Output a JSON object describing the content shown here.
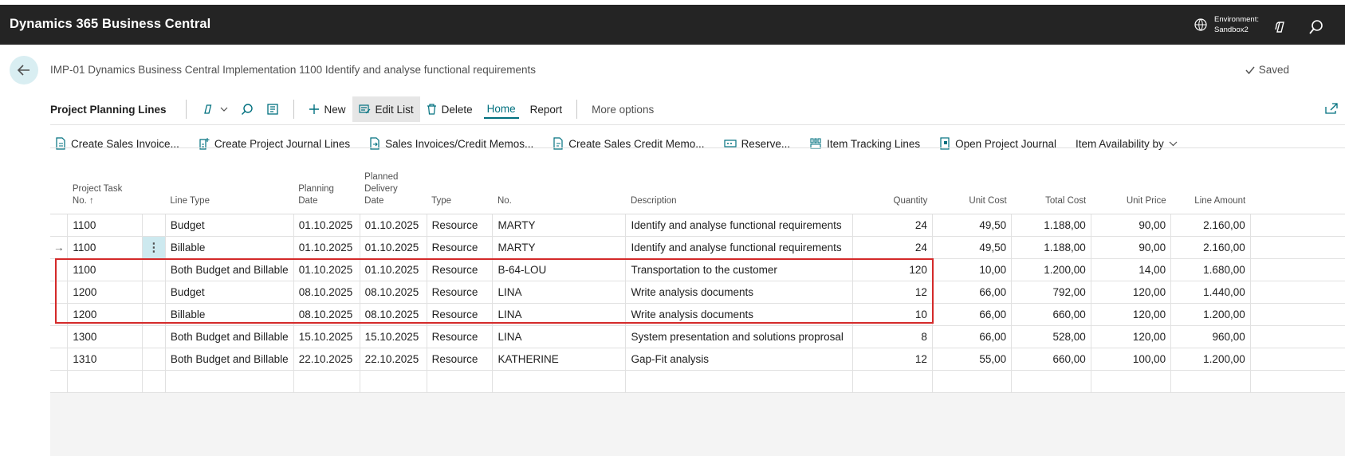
{
  "app": {
    "title": "Dynamics 365 Business Central",
    "environment_label": "Environment:",
    "environment_value": "Sandbox2"
  },
  "header": {
    "breadcrumb": "IMP-01 Dynamics Business Central Implementation 1100 Identify and analyse functional requirements",
    "saved": "Saved"
  },
  "actionbar": {
    "page_name": "Project Planning Lines",
    "new_label": "New",
    "edit_list_label": "Edit List",
    "delete_label": "Delete",
    "home_label": "Home",
    "report_label": "Report",
    "more_options_label": "More options"
  },
  "promoted": {
    "create_sales_invoice": "Create Sales Invoice...",
    "create_project_journal_lines": "Create Project Journal Lines",
    "sales_invoices_credit_memos": "Sales Invoices/Credit Memos...",
    "create_sales_credit_memo": "Create Sales Credit Memo...",
    "reserve": "Reserve...",
    "item_tracking_lines": "Item Tracking Lines",
    "open_project_journal": "Open Project Journal",
    "item_availability_by": "Item Availability by"
  },
  "table": {
    "headers": {
      "project_task_no_1": "Project Task",
      "project_task_no_2": "No. ↑",
      "line_type": "Line Type",
      "planning_date_1": "Planning",
      "planning_date_2": "Date",
      "planned_delivery_1": "Planned",
      "planned_delivery_2": "Delivery",
      "planned_delivery_3": "Date",
      "type": "Type",
      "no": "No.",
      "description": "Description",
      "quantity": "Quantity",
      "unit_cost": "Unit Cost",
      "total_cost": "Total Cost",
      "unit_price": "Unit Price",
      "line_amount": "Line Amount"
    },
    "current_row_indicator": "→",
    "rows": [
      {
        "task": "1100",
        "line_type": "Budget",
        "planning_date": "01.10.2025",
        "delivery_date": "01.10.2025",
        "type": "Resource",
        "no": "MARTY",
        "description": "Identify and analyse functional requirements",
        "quantity": "24",
        "unit_cost": "49,50",
        "total_cost": "1.188,00",
        "unit_price": "90,00",
        "line_amount": "2.160,00"
      },
      {
        "task": "1100",
        "line_type": "Billable",
        "planning_date": "01.10.2025",
        "delivery_date": "01.10.2025",
        "type": "Resource",
        "no": "MARTY",
        "description": "Identify and analyse functional requirements",
        "quantity": "24",
        "unit_cost": "49,50",
        "total_cost": "1.188,00",
        "unit_price": "90,00",
        "line_amount": "2.160,00"
      },
      {
        "task": "1100",
        "line_type": "Both Budget and Billable",
        "planning_date": "01.10.2025",
        "delivery_date": "01.10.2025",
        "type": "Resource",
        "no": "B-64-LOU",
        "description": "Transportation to the customer",
        "quantity": "120",
        "unit_cost": "10,00",
        "total_cost": "1.200,00",
        "unit_price": "14,00",
        "line_amount": "1.680,00"
      },
      {
        "task": "1200",
        "line_type": "Budget",
        "planning_date": "08.10.2025",
        "delivery_date": "08.10.2025",
        "type": "Resource",
        "no": "LINA",
        "description": "Write analysis documents",
        "quantity": "12",
        "unit_cost": "66,00",
        "total_cost": "792,00",
        "unit_price": "120,00",
        "line_amount": "1.440,00"
      },
      {
        "task": "1200",
        "line_type": "Billable",
        "planning_date": "08.10.2025",
        "delivery_date": "08.10.2025",
        "type": "Resource",
        "no": "LINA",
        "description": "Write analysis documents",
        "quantity": "10",
        "unit_cost": "66,00",
        "total_cost": "660,00",
        "unit_price": "120,00",
        "line_amount": "1.200,00"
      },
      {
        "task": "1300",
        "line_type": "Both Budget and Billable",
        "planning_date": "15.10.2025",
        "delivery_date": "15.10.2025",
        "type": "Resource",
        "no": "LINA",
        "description": "System presentation and solutions proprosal",
        "quantity": "8",
        "unit_cost": "66,00",
        "total_cost": "528,00",
        "unit_price": "120,00",
        "line_amount": "960,00"
      },
      {
        "task": "1310",
        "line_type": "Both Budget and Billable",
        "planning_date": "22.10.2025",
        "delivery_date": "22.10.2025",
        "type": "Resource",
        "no": "KATHERINE",
        "description": "Gap-Fit analysis",
        "quantity": "12",
        "unit_cost": "55,00",
        "total_cost": "660,00",
        "unit_price": "100,00",
        "line_amount": "1.200,00"
      }
    ]
  },
  "colors": {
    "topbar": "#242424",
    "accent": "#00707f",
    "highlight_box": "#d42a2a"
  }
}
